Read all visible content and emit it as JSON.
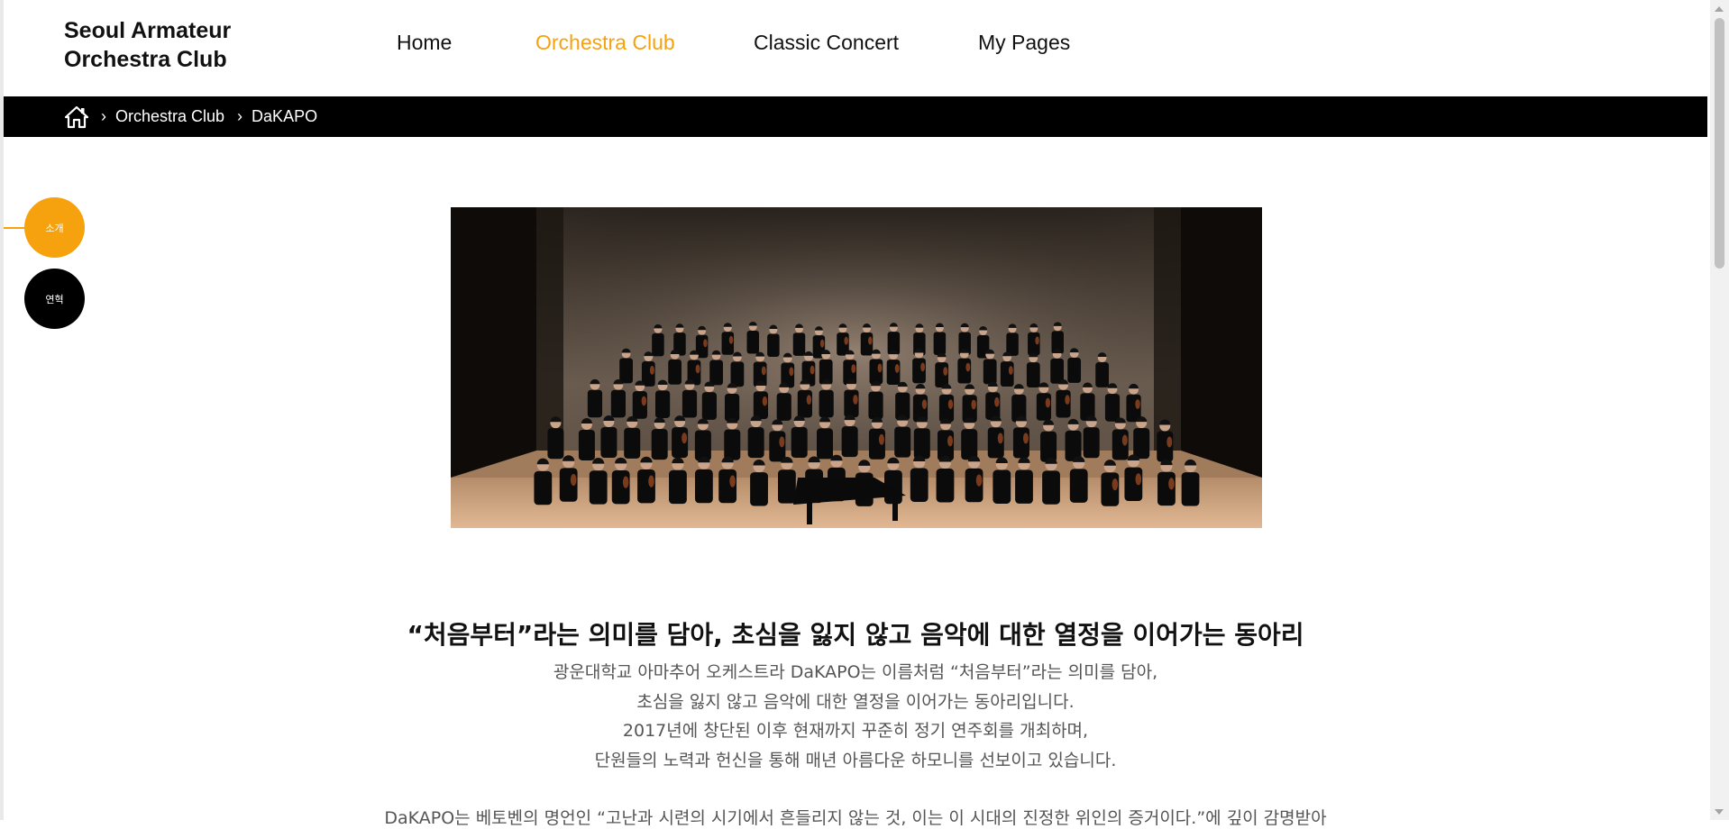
{
  "header": {
    "logo_line1": "Seoul Armateur",
    "logo_line2": "Orchestra Club",
    "nav": [
      {
        "label": "Home"
      },
      {
        "label": "Orchestra Club"
      },
      {
        "label": "Classic Concert"
      },
      {
        "label": "My Pages"
      }
    ],
    "active_nav": "Orchestra Club"
  },
  "breadcrumb": {
    "home_icon": "home-icon",
    "items": [
      "Orchestra Club",
      "DaKAPO"
    ]
  },
  "side_menu": {
    "items": [
      {
        "label": "소개",
        "active": true
      },
      {
        "label": "연혁",
        "active": false
      }
    ]
  },
  "main": {
    "photo_alt": "orchestra-group-photo",
    "headline": "“처음부터”라는 의미를 담아, 초심을 잃지 않고 음악에 대한 열정을 이어가는 동아리",
    "description": [
      "광운대학교 아마추어 오케스트라 DaKAPO는 이름처럼 “처음부터”라는 의미를 담아,",
      "초심을 잃지 않고 음악에 대한 열정을 이어가는 동아리입니다.",
      "2017년에 창단된 이후 현재까지 꾸준히 정기 연주회를 개최하며,",
      "단원들의 노력과 헌신을 통해 매년 아름다운 하모니를 선보이고 있습니다."
    ],
    "description2": "DaKAPO는 베토벤의 명언인 “고난과 시련의 시기에서 흔들리지 않는 것, 이는 이 시대의 진정한 위인의 증거이다.”에 깊이 감명받아"
  },
  "colors": {
    "accent": "#f5a20e",
    "breadcrumb_bg": "#000000",
    "text": "#111111",
    "muted": "#555555"
  }
}
